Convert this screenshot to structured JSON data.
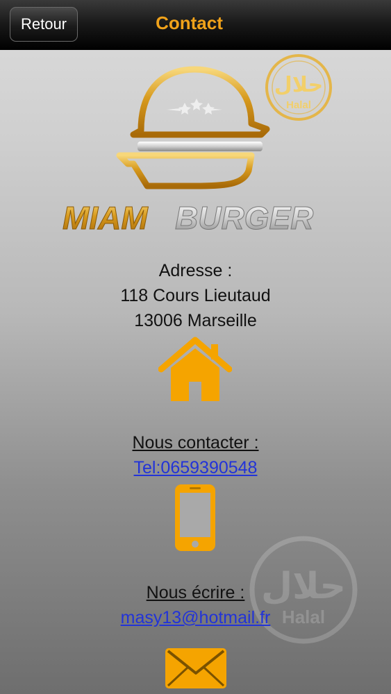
{
  "header": {
    "back_label": "Retour",
    "title": "Contact"
  },
  "logo": {
    "brand_part1": "MIAM",
    "brand_part2": "BURGER",
    "halal_arabic": "حلال",
    "halal_latin": "Halal"
  },
  "address": {
    "label": "Adresse :",
    "street": "118 Cours Lieutaud",
    "city": "13006 Marseille"
  },
  "contact": {
    "heading": "Nous contacter :",
    "phone": "Tel:0659390548"
  },
  "email": {
    "heading": "Nous écrire :",
    "address": "masy13@hotmail.fr"
  },
  "icons": {
    "home": "home-icon",
    "phone": "smartphone-icon",
    "mail": "envelope-icon"
  },
  "colors": {
    "accent": "#f0a21a",
    "icon": "#f5a400",
    "link": "#2233d8"
  }
}
